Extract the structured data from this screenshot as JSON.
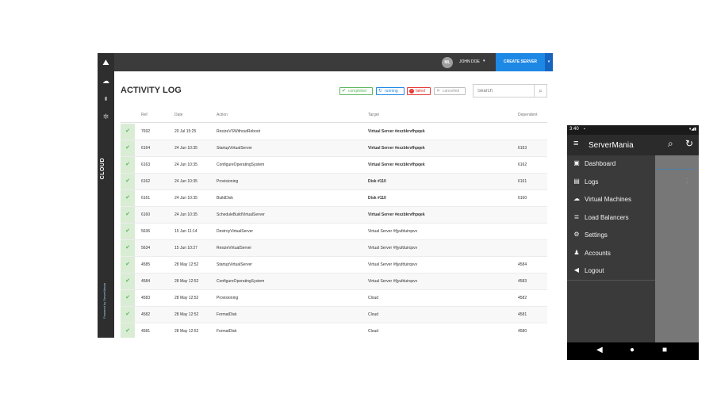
{
  "desktop": {
    "rail": {
      "items": [
        {
          "name": "cloud-icon",
          "glyph": "☁"
        },
        {
          "name": "stats-icon",
          "glyph": "▮"
        },
        {
          "name": "settings-icon",
          "glyph": "✲"
        }
      ],
      "section_label": "CLOUD",
      "powered_by": "Powered by ServerMania"
    },
    "topbar": {
      "avatar_initials": "ML",
      "user_name": "JOHN DOE",
      "user_caret": "▾",
      "create_button": "CREATE SERVER",
      "create_caret": "▾"
    },
    "page_title": "ACTIVITY LOG",
    "filters": {
      "completed": "completed",
      "running": "running",
      "failed": "failed",
      "cancelled": "cancelled"
    },
    "search": {
      "placeholder": "Search"
    },
    "columns": {
      "ref": "Ref",
      "date": "Date",
      "action": "Action",
      "target": "Target",
      "dependent": "Dependent"
    },
    "rows": [
      {
        "ref": "7692",
        "date": "20 Jul 15:25",
        "action": "ResizeVSWithoutReboot",
        "target": "Virtual Server #exzbkrvfhpqek",
        "target_bold": true,
        "dependent": ""
      },
      {
        "ref": "6164",
        "date": "24 Jun 10:35",
        "action": "StartupVirtualServer",
        "target": "Virtual Server #exzbkrvfhpqek",
        "target_bold": true,
        "dependent": "6163"
      },
      {
        "ref": "6163",
        "date": "24 Jun 10:35",
        "action": "ConfigureOperatingSystem",
        "target": "Virtual Server #exzbkrvfhpqek",
        "target_bold": true,
        "dependent": "6162"
      },
      {
        "ref": "6162",
        "date": "24 Jun 10:35",
        "action": "Provisioning",
        "target": "Disk #110",
        "target_bold": true,
        "dependent": "6161"
      },
      {
        "ref": "6161",
        "date": "24 Jun 10:35",
        "action": "BuildDisk",
        "target": "Disk #110",
        "target_bold": true,
        "dependent": "6160"
      },
      {
        "ref": "6160",
        "date": "24 Jun 10:35",
        "action": "ScheduleBuildVirtualServer",
        "target": "Virtual Server #exzbkrvfhpqek",
        "target_bold": true,
        "dependent": ""
      },
      {
        "ref": "5636",
        "date": "15 Jun 11:14",
        "action": "DestroyVirtualServer",
        "target": "Virtual Server #fjyufduirqsvv",
        "target_bold": false,
        "dependent": ""
      },
      {
        "ref": "5634",
        "date": "15 Jun 10:27",
        "action": "ResizeVirtualServer",
        "target": "Virtual Server #fjyufduirqsvv",
        "target_bold": false,
        "dependent": ""
      },
      {
        "ref": "4585",
        "date": "28 May 12:52",
        "action": "StartupVirtualServer",
        "target": "Virtual Server #fjyufduirqsvv",
        "target_bold": false,
        "dependent": "4584"
      },
      {
        "ref": "4584",
        "date": "28 May 12:52",
        "action": "ConfigureOperatingSystem",
        "target": "Virtual Server #fjyufduirqsvv",
        "target_bold": false,
        "dependent": "4583"
      },
      {
        "ref": "4583",
        "date": "28 May 12:52",
        "action": "Provisioning",
        "target": "Cloud",
        "target_bold": false,
        "dependent": "4582"
      },
      {
        "ref": "4582",
        "date": "28 May 12:52",
        "action": "FormatDisk",
        "target": "Cloud",
        "target_bold": false,
        "dependent": "4581"
      },
      {
        "ref": "4581",
        "date": "28 May 12:52",
        "action": "FormatDisk",
        "target": "Cloud",
        "target_bold": false,
        "dependent": "4580"
      }
    ]
  },
  "phone": {
    "status_time": "3:40",
    "status_notif": "▪",
    "status_icons": "▾◢▮",
    "app_title": "ServerMania",
    "menu_icon": "≡",
    "search_glyph": "⌕",
    "refresh_glyph": "↻",
    "drawer": [
      {
        "name": "dashboard",
        "label": "Dashboard",
        "glyph": "▣"
      },
      {
        "name": "logs",
        "label": "Logs",
        "glyph": "▤"
      },
      {
        "name": "virtual-machines",
        "label": "Virtual Machines",
        "glyph": "☁"
      },
      {
        "name": "load-balancers",
        "label": "Load Balancers",
        "glyph": "≣"
      },
      {
        "name": "settings",
        "label": "Settings",
        "glyph": "⚙"
      },
      {
        "name": "accounts",
        "label": "Accounts",
        "glyph": "♟"
      },
      {
        "name": "logout",
        "label": "Logout",
        "glyph": "◀"
      }
    ],
    "nav": {
      "back": "◀",
      "home": "●",
      "recents": "■"
    }
  },
  "colors": {
    "accent": "#1e88e5",
    "success": "#5cb85c",
    "danger": "#e53935"
  }
}
